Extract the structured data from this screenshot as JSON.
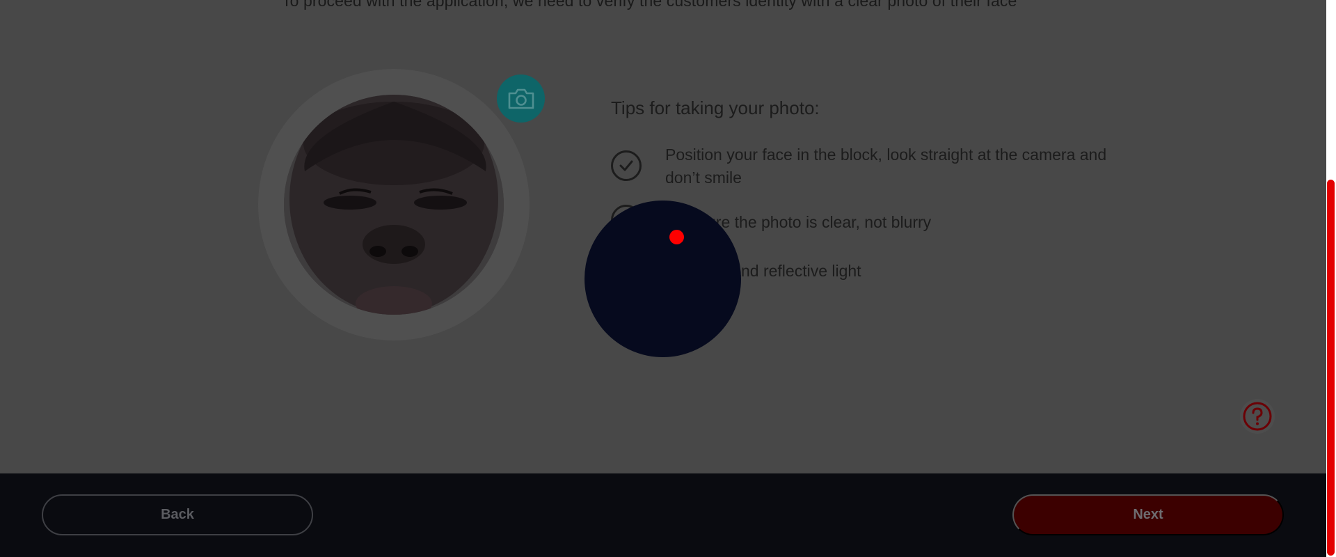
{
  "intro": {
    "text": "To proceed with the application, we need to verify the customers identity with a clear photo of their face"
  },
  "photo": {
    "alt": "customer face photo",
    "camera_icon": "camera-icon"
  },
  "tips": {
    "title": "Tips for taking your photo:",
    "items": [
      {
        "icon": "checkmark-icon",
        "text": "Position your face in the block, look straight at the camera and don’t smile"
      },
      {
        "icon": "checkmark-icon",
        "text": "ure the photo is clear, not blurry"
      },
      {
        "icon": "checkmark-icon",
        "text": "n and reflective light"
      }
    ]
  },
  "help": {
    "icon": "question-icon"
  },
  "footer": {
    "back_label": "Back",
    "next_label": "Next"
  },
  "colors": {
    "accent": "#e30000",
    "camera_badge": "#0e6568",
    "footer_bg": "#0a0b10"
  }
}
